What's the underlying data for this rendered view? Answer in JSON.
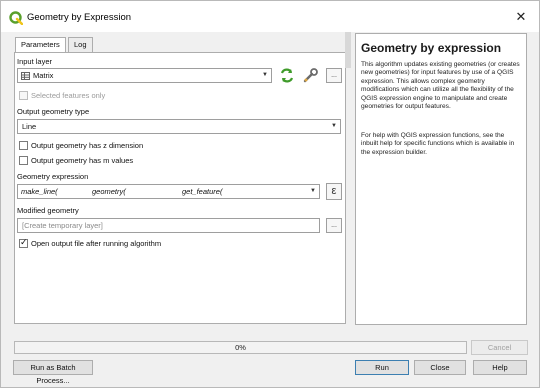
{
  "window": {
    "title": "Geometry by Expression",
    "icon": "qgis-logo-icon",
    "close_glyph": "✕"
  },
  "tabs": [
    {
      "label": "Parameters",
      "active": true
    },
    {
      "label": "Log",
      "active": false
    }
  ],
  "params": {
    "input_layer_label": "Input layer",
    "input_layer_value": "Matrix",
    "selected_features_label": "Selected features only",
    "selected_features_checked": false,
    "output_geom_type_label": "Output geometry type",
    "output_geom_type_value": "Line",
    "z_dimension_label": "Output geometry has z dimension",
    "z_dimension_checked": false,
    "m_values_label": "Output geometry has m values",
    "m_values_checked": false,
    "geom_expression_label": "Geometry expression",
    "geom_expression_parts": [
      "make_line(",
      "geometry(",
      "get_feature("
    ],
    "modified_geometry_label": "Modified geometry",
    "modified_geometry_placeholder": "[Create temporary layer]",
    "open_output_label": "Open output file after running algorithm",
    "open_output_checked": true,
    "browse_label": "...",
    "epsilon_label": "ε"
  },
  "help": {
    "title": "Geometry by expression",
    "paragraph1": "This algorithm updates existing geometries (or creates new geometries) for input features by use of a QGIS expression. This allows complex geometry modifications which can utilize all the flexibility of the QGIS expression engine to manipulate and create geometries for output features.",
    "paragraph2": "For help with QGIS expression functions, see the inbuilt help for specific functions which is available in the expression builder."
  },
  "progress": {
    "value": 0,
    "text": "0%"
  },
  "buttons": {
    "cancel": "Cancel",
    "batch": "Run as Batch Process...",
    "run": "Run",
    "close": "Close",
    "help": "Help"
  },
  "colors": {
    "progress_fill": "#06b025",
    "qgis_green": "#5aa02c",
    "qgis_yellow": "#f0c419",
    "default_button_border": "#3c7fb1"
  }
}
